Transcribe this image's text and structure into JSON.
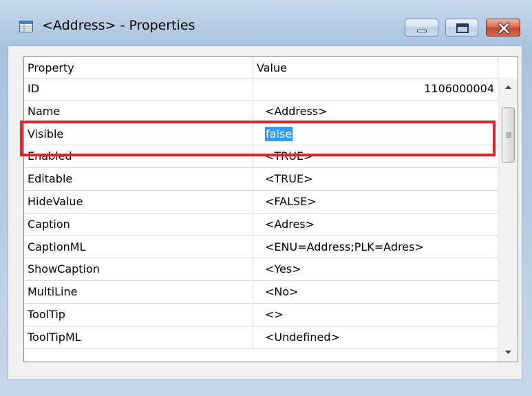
{
  "window": {
    "title": "<Address> - Properties",
    "icon": "properties-grid-icon"
  },
  "controls": {
    "minimize_icon": "minimize-icon",
    "maximize_icon": "maximize-icon",
    "close_icon": "close-icon"
  },
  "table": {
    "columns": [
      "Property",
      "Value"
    ],
    "rows": [
      {
        "property": "ID",
        "value": "1106000004"
      },
      {
        "property": "Name",
        "value": "<Address>"
      },
      {
        "property": "Visible",
        "value": "false"
      },
      {
        "property": "Enabled",
        "value": "<TRUE>"
      },
      {
        "property": "Editable",
        "value": "<TRUE>"
      },
      {
        "property": "HideValue",
        "value": "<FALSE>"
      },
      {
        "property": "Caption",
        "value": "<Adres>"
      },
      {
        "property": "CaptionML",
        "value": "<ENU=Address;PLK=Adres>"
      },
      {
        "property": "ShowCaption",
        "value": "<Yes>"
      },
      {
        "property": "MultiLine",
        "value": "<No>"
      },
      {
        "property": "ToolTip",
        "value": "<>"
      },
      {
        "property": "ToolTipML",
        "value": "<Undefined>"
      }
    ],
    "selected_row": 2
  },
  "colors": {
    "highlight_border": "#e8202a",
    "selection": "#3399ff"
  }
}
